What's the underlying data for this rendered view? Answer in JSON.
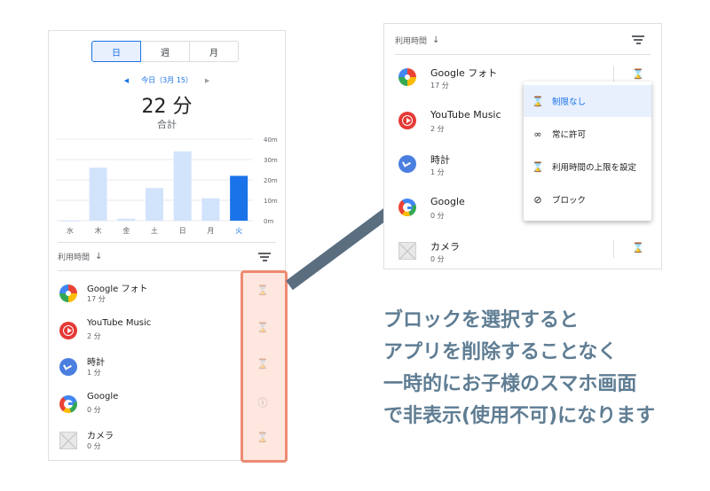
{
  "left": {
    "segments": [
      "日",
      "週",
      "月"
    ],
    "date_label": "今日（3月 15）",
    "total_value": "22 分",
    "total_label": "合計",
    "chart_data": {
      "type": "bar",
      "categories": [
        "水",
        "木",
        "金",
        "土",
        "日",
        "月",
        "火"
      ],
      "values": [
        0,
        26,
        1,
        16,
        34,
        11,
        22
      ],
      "ylim": [
        0,
        40
      ],
      "yticks": [
        "0m",
        "10m",
        "20m",
        "30m",
        "40m"
      ],
      "highlight_index": 6,
      "colors": {
        "bar": "#d2e3fc",
        "highlight": "#1a73e8"
      }
    },
    "sort_label": "利用時間",
    "apps": [
      {
        "name": "Google フォト",
        "time": "17 分",
        "icon": "google-photos-icon",
        "action": "⌛"
      },
      {
        "name": "YouTube Music",
        "time": "2 分",
        "icon": "youtube-music-icon",
        "action": "⌛"
      },
      {
        "name": "時計",
        "time": "1 分",
        "icon": "clock-icon",
        "action": "⌛"
      },
      {
        "name": "Google",
        "time": "0 分",
        "icon": "google-icon",
        "action": "ⓘ"
      },
      {
        "name": "カメラ",
        "time": "0 分",
        "icon": "camera-icon",
        "action": "⌛"
      }
    ]
  },
  "right": {
    "sort_label": "利用時間",
    "apps": [
      {
        "name": "Google フォト",
        "time": "17 分"
      },
      {
        "name": "YouTube Music",
        "time": "2 分"
      },
      {
        "name": "時計",
        "time": "1 分"
      },
      {
        "name": "Google",
        "time": "0 分"
      },
      {
        "name": "カメラ",
        "time": "0 分"
      }
    ],
    "menu": [
      {
        "label": "制限なし",
        "icon": "⌛",
        "selected": true
      },
      {
        "label": "常に許可",
        "icon": "∞",
        "selected": false
      },
      {
        "label": "利用時間の上限を設定",
        "icon": "⌛",
        "selected": false
      },
      {
        "label": "ブロック",
        "icon": "⊘",
        "selected": false
      }
    ]
  },
  "caption": [
    "ブロックを選択すると",
    "アプリを削除することなく",
    "一時的にお子様のスマホ画面",
    "で非表示(使用不可)になります"
  ],
  "colors": {
    "accent": "#1a73e8",
    "highlight_border": "#ee8a72",
    "arrow": "#5a6e80",
    "caption": "#5f7d93"
  }
}
